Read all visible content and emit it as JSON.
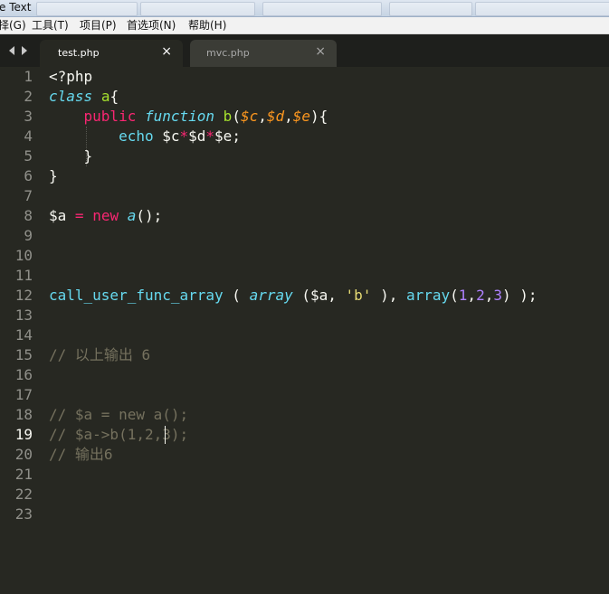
{
  "window": {
    "title": "e Text"
  },
  "menubar": {
    "items": [
      "择(G)",
      "工具(T)",
      "项目(P)",
      "首选项(N)",
      "帮助(H)"
    ]
  },
  "tabs": [
    {
      "label": "test.php",
      "close": "×"
    },
    {
      "label": "mvc.php",
      "close": "×"
    }
  ],
  "editor": {
    "line_numbers": [
      "1",
      "2",
      "3",
      "4",
      "5",
      "6",
      "7",
      "8",
      "9",
      "10",
      "11",
      "12",
      "13",
      "14",
      "15",
      "16",
      "17",
      "18",
      "19",
      "20",
      "21",
      "22",
      "23"
    ],
    "current_line": 19,
    "caret": {
      "line": 19,
      "column": 13
    },
    "lines": [
      [
        {
          "t": "<?php",
          "c": ""
        }
      ],
      [
        {
          "t": "class",
          "c": "storage"
        },
        {
          "t": " ",
          "c": ""
        },
        {
          "t": "a",
          "c": "class"
        },
        {
          "t": "{",
          "c": ""
        }
      ],
      [
        {
          "t": "    ",
          "c": ""
        },
        {
          "t": "public",
          "c": "keyword"
        },
        {
          "t": " ",
          "c": ""
        },
        {
          "t": "function",
          "c": "storage"
        },
        {
          "t": " ",
          "c": ""
        },
        {
          "t": "b",
          "c": "class"
        },
        {
          "t": "(",
          "c": ""
        },
        {
          "t": "$c",
          "c": "param"
        },
        {
          "t": ",",
          "c": ""
        },
        {
          "t": "$d",
          "c": "param"
        },
        {
          "t": ",",
          "c": ""
        },
        {
          "t": "$e",
          "c": "param"
        },
        {
          "t": "){",
          "c": ""
        }
      ],
      [
        {
          "t": "        ",
          "c": ""
        },
        {
          "t": "echo",
          "c": "func"
        },
        {
          "t": " $c",
          "c": ""
        },
        {
          "t": "*",
          "c": "keyword"
        },
        {
          "t": "$d",
          "c": ""
        },
        {
          "t": "*",
          "c": "keyword"
        },
        {
          "t": "$e;",
          "c": ""
        }
      ],
      [
        {
          "t": "    }",
          "c": ""
        }
      ],
      [
        {
          "t": "}",
          "c": ""
        }
      ],
      [],
      [
        {
          "t": "$a ",
          "c": ""
        },
        {
          "t": "=",
          "c": "keyword"
        },
        {
          "t": " ",
          "c": ""
        },
        {
          "t": "new",
          "c": "keyword"
        },
        {
          "t": " ",
          "c": ""
        },
        {
          "t": "a",
          "c": "storage"
        },
        {
          "t": "();",
          "c": ""
        }
      ],
      [],
      [],
      [],
      [
        {
          "t": "call_user_func_array",
          "c": "func"
        },
        {
          "t": " ( ",
          "c": ""
        },
        {
          "t": "array",
          "c": "storage"
        },
        {
          "t": " ($a, ",
          "c": ""
        },
        {
          "t": "'b'",
          "c": "string"
        },
        {
          "t": " ), ",
          "c": ""
        },
        {
          "t": "array",
          "c": "func"
        },
        {
          "t": "(",
          "c": ""
        },
        {
          "t": "1",
          "c": "num"
        },
        {
          "t": ",",
          "c": ""
        },
        {
          "t": "2",
          "c": "num"
        },
        {
          "t": ",",
          "c": ""
        },
        {
          "t": "3",
          "c": "num"
        },
        {
          "t": ") );",
          "c": ""
        }
      ],
      [],
      [],
      [
        {
          "t": "// 以上输出 6",
          "c": "comment"
        }
      ],
      [],
      [],
      [
        {
          "t": "// $a = new a();",
          "c": "comment"
        }
      ],
      [
        {
          "t": "// $a->b(1,2,3);",
          "c": "comment"
        }
      ],
      [
        {
          "t": "// 输出6",
          "c": "comment"
        }
      ],
      [],
      [],
      []
    ]
  },
  "colors": {
    "background": "#272822",
    "foreground": "#f8f8f2",
    "keyword": "#f92672",
    "storage": "#66d9ef",
    "class": "#a6e22e",
    "param": "#fd971f",
    "string": "#e6db74",
    "number": "#ae81ff",
    "comment": "#75715e"
  }
}
